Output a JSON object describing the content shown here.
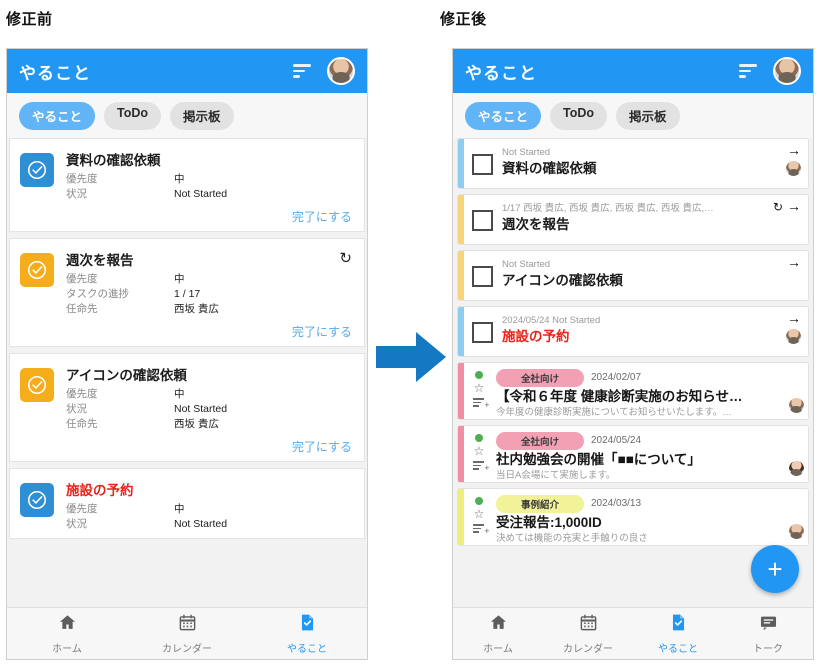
{
  "captions": {
    "before": "修正前",
    "after": "修正後"
  },
  "colors": {
    "brand_blue": "#2196f3",
    "pill_active": "#61b4f5",
    "alert_red": "#e8231a",
    "link_blue": "#57a9e8",
    "badge_blue": "#2e8fd4",
    "badge_amber": "#f5ad1c",
    "stripe_blue": "#8fcdf0",
    "stripe_amber": "#f7d479",
    "stripe_pink": "#f08fa3",
    "stripe_yellow": "#eeee7a",
    "tag_pink": "#f3a0b5",
    "tag_yellow": "#f2f298",
    "dot_green": "#4caf50"
  },
  "before": {
    "appbar": {
      "title": "やること",
      "sort_icon": "sort-descending-icon",
      "avatar": "user-avatar"
    },
    "tabs": [
      {
        "label": "やること",
        "active": true
      },
      {
        "label": "ToDo",
        "active": false
      },
      {
        "label": "掲示板",
        "active": false
      }
    ],
    "cards": [
      {
        "title": "資料の確認依頼",
        "alert": false,
        "badge": "blue",
        "recurring": false,
        "fields": [
          {
            "key": "優先度",
            "value": "中"
          },
          {
            "key": "状況",
            "value": "Not Started"
          }
        ],
        "action": "完了にする"
      },
      {
        "title": "週次を報告",
        "alert": false,
        "badge": "amber",
        "recurring": true,
        "fields": [
          {
            "key": "優先度",
            "value": "中"
          },
          {
            "key": "タスクの進捗",
            "value": "1 / 17"
          },
          {
            "key": "任命先",
            "value": "西坂 貴広"
          }
        ],
        "action": "完了にする"
      },
      {
        "title": "アイコンの確認依頼",
        "alert": false,
        "badge": "amber",
        "recurring": false,
        "fields": [
          {
            "key": "優先度",
            "value": "中"
          },
          {
            "key": "状況",
            "value": "Not Started"
          },
          {
            "key": "任命先",
            "value": "西坂 貴広"
          }
        ],
        "action": "完了にする"
      },
      {
        "title": "施設の予約",
        "alert": true,
        "badge": "blue",
        "recurring": false,
        "fields": [
          {
            "key": "優先度",
            "value": "中"
          },
          {
            "key": "状況",
            "value": "Not Started"
          }
        ],
        "action": ""
      }
    ],
    "nav": [
      {
        "label": "ホーム",
        "icon": "home-icon",
        "active": false
      },
      {
        "label": "カレンダー",
        "icon": "calendar-icon",
        "active": false
      },
      {
        "label": "やること",
        "icon": "task-file-icon",
        "active": true
      }
    ]
  },
  "after": {
    "appbar": {
      "title": "やること",
      "sort_icon": "sort-descending-icon",
      "avatar": "user-avatar"
    },
    "tabs": [
      {
        "label": "やること",
        "active": true
      },
      {
        "label": "ToDo",
        "active": false
      },
      {
        "label": "掲示板",
        "active": false
      }
    ],
    "tasks": [
      {
        "stripe": "blue",
        "meta": "Not Started",
        "title": "資料の確認依頼",
        "alert": false,
        "recurring": false,
        "has_avatar": true,
        "avatar_kind": "m"
      },
      {
        "stripe": "amber",
        "meta": "1/17 西坂 貴広, 西坂 貴広, 西坂 貴広, 西坂 貴広,…",
        "title": "週次を報告",
        "alert": false,
        "recurring": true,
        "has_avatar": false,
        "avatar_kind": "m"
      },
      {
        "stripe": "amber",
        "meta": "Not Started",
        "title": "アイコンの確認依頼",
        "alert": false,
        "recurring": false,
        "has_avatar": false,
        "avatar_kind": "m"
      },
      {
        "stripe": "blue",
        "meta": "2024/05/24 Not Started",
        "title": "施設の予約",
        "alert": true,
        "recurring": false,
        "has_avatar": true,
        "avatar_kind": "m"
      }
    ],
    "announcements": [
      {
        "stripe": "pink",
        "tag": "全社向け",
        "tag_color": "pink",
        "date": "2024/02/07",
        "title": "【令和６年度 健康診断実施のお知らせ…",
        "subtitle": "今年度の健康診断実施についてお知らせいたします。…",
        "avatar_kind": "m"
      },
      {
        "stripe": "pink",
        "tag": "全社向け",
        "tag_color": "pink",
        "date": "2024/05/24",
        "title": "社内勉強会の開催「■■について」",
        "subtitle": "当日A会場にて実施します。",
        "avatar_kind": "f"
      },
      {
        "stripe": "yellow",
        "tag": "事例紹介",
        "tag_color": "yellow",
        "date": "2024/03/13",
        "title": "受注報告:1,000ID",
        "subtitle": "決めては機能の充実と手触りの良さ",
        "avatar_kind": "m"
      }
    ],
    "fab": {
      "label": "+",
      "icon": "plus-icon"
    },
    "nav": [
      {
        "label": "ホーム",
        "icon": "home-icon",
        "active": false
      },
      {
        "label": "カレンダー",
        "icon": "calendar-icon",
        "active": false
      },
      {
        "label": "やること",
        "icon": "task-file-icon",
        "active": true
      },
      {
        "label": "トーク",
        "icon": "chat-icon",
        "active": false
      }
    ]
  }
}
